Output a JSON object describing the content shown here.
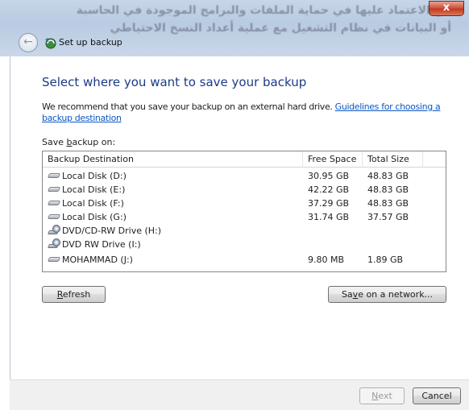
{
  "window": {
    "title": "Set up backup",
    "background_text": "من الاعتماد عليها في حماية الملفات والبرامج الموجودة في الحاسبة",
    "background_text_2": "أو البيانات في نظام التشغيل مع عملية أعداد النسخ الاحتياطي",
    "close_symbol": "x",
    "back_symbol": "←"
  },
  "main": {
    "heading": "Select where you want to save your backup",
    "recommend_text": "We recommend that you save your backup on an external hard drive. ",
    "guidelines_link": "Guidelines for choosing a backup destination",
    "save_on_prefix": "Save ",
    "save_on_underlined": "b",
    "save_on_suffix": "ackup on:"
  },
  "table": {
    "headers": {
      "destination": "Backup Destination",
      "free_space": "Free Space",
      "total_size": "Total Size"
    },
    "rows": [
      {
        "name": "Local Disk (D:)",
        "free": "30.95 GB",
        "total": "48.83 GB",
        "icon": "hard-drive-icon"
      },
      {
        "name": "Local Disk (E:)",
        "free": "42.22 GB",
        "total": "48.83 GB",
        "icon": "hard-drive-icon"
      },
      {
        "name": "Local Disk (F:)",
        "free": "37.29 GB",
        "total": "48.83 GB",
        "icon": "hard-drive-icon"
      },
      {
        "name": "Local Disk (G:)",
        "free": "31.74 GB",
        "total": "37.57 GB",
        "icon": "hard-drive-icon"
      },
      {
        "name": "DVD/CD-RW Drive (H:)",
        "free": "",
        "total": "",
        "icon": "dvd-drive-icon"
      },
      {
        "name": "DVD RW Drive (I:)",
        "free": "",
        "total": "",
        "icon": "dvd-drive-icon"
      },
      {
        "name": "MOHAMMAD (J:)",
        "free": "9.80 MB",
        "total": "1.89 GB",
        "icon": "usb-drive-icon"
      }
    ]
  },
  "buttons": {
    "refresh_underlined": "R",
    "refresh_rest": "efresh",
    "network_prefix": "Sa",
    "network_underlined": "v",
    "network_suffix": "e on a network...",
    "next_underlined": "N",
    "next_rest": "ext",
    "cancel": "Cancel"
  },
  "colors": {
    "heading": "#1b3a86",
    "link": "#0b58c2",
    "close_button": "#c13a21"
  }
}
